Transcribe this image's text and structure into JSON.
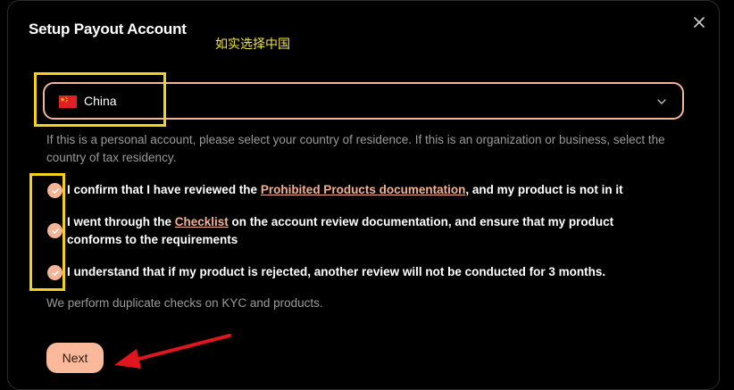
{
  "dialog": {
    "title": "Setup Payout Account",
    "annotation_note": "如实选择中国",
    "close_icon": "close-icon"
  },
  "country": {
    "flag_icon": "china-flag-icon",
    "selected": "China",
    "chevron_icon": "chevron-down-icon"
  },
  "help_text": "If this is a personal account, please select your country of residence. If this is an organization or business, select the country of tax residency.",
  "confirmations": [
    {
      "checked": true,
      "before": "I confirm that I have reviewed the ",
      "link": "Prohibited Products documentation",
      "after": ", and my product is not in it"
    },
    {
      "checked": true,
      "before": "I went through the ",
      "link": "Checklist",
      "after": " on the account review documentation, and ensure that my product conforms to the requirements"
    },
    {
      "checked": true,
      "before": "I understand that if my product is rejected, another review will not be conducted for 3 months.",
      "link": "",
      "after": ""
    }
  ],
  "footnote": "We perform duplicate checks on KYC and products.",
  "next_label": "Next",
  "colors": {
    "accent": "#f9b99a",
    "annotation_box": "#f4d21a",
    "annotation_arrow": "#e0161e",
    "note_text": "#f0e443"
  }
}
